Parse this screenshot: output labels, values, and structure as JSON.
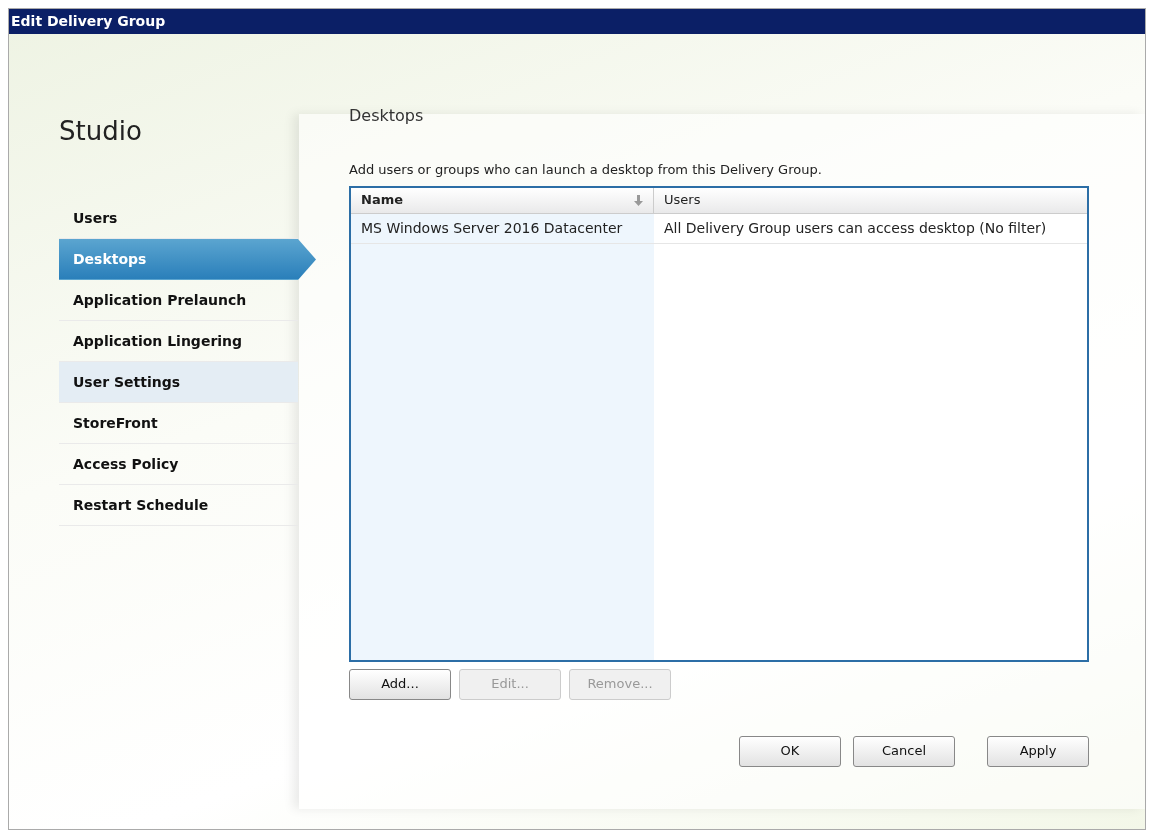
{
  "window": {
    "title": "Edit Delivery Group"
  },
  "sidebar": {
    "title": "Studio",
    "items": [
      {
        "label": "Users",
        "selected": false,
        "hovered": false
      },
      {
        "label": "Desktops",
        "selected": true,
        "hovered": false
      },
      {
        "label": "Application Prelaunch",
        "selected": false,
        "hovered": false
      },
      {
        "label": "Application Lingering",
        "selected": false,
        "hovered": false
      },
      {
        "label": "User Settings",
        "selected": false,
        "hovered": true
      },
      {
        "label": "StoreFront",
        "selected": false,
        "hovered": false
      },
      {
        "label": "Access Policy",
        "selected": false,
        "hovered": false
      },
      {
        "label": "Restart Schedule",
        "selected": false,
        "hovered": false
      }
    ]
  },
  "page": {
    "heading": "Desktops",
    "description": "Add users or groups who can launch a desktop from this Delivery Group."
  },
  "table": {
    "columns": [
      {
        "label": "Name",
        "sorted": true
      },
      {
        "label": "Users",
        "sorted": false
      }
    ],
    "rows": [
      [
        "MS Windows Server 2016 Datacenter",
        "All Delivery Group users can access desktop (No filter)"
      ]
    ]
  },
  "table_buttons": [
    {
      "label": "Add...",
      "disabled": false
    },
    {
      "label": "Edit...",
      "disabled": true
    },
    {
      "label": "Remove...",
      "disabled": true
    }
  ],
  "dialog_buttons": [
    {
      "label": "OK"
    },
    {
      "label": "Cancel"
    },
    {
      "label": "Apply"
    }
  ]
}
